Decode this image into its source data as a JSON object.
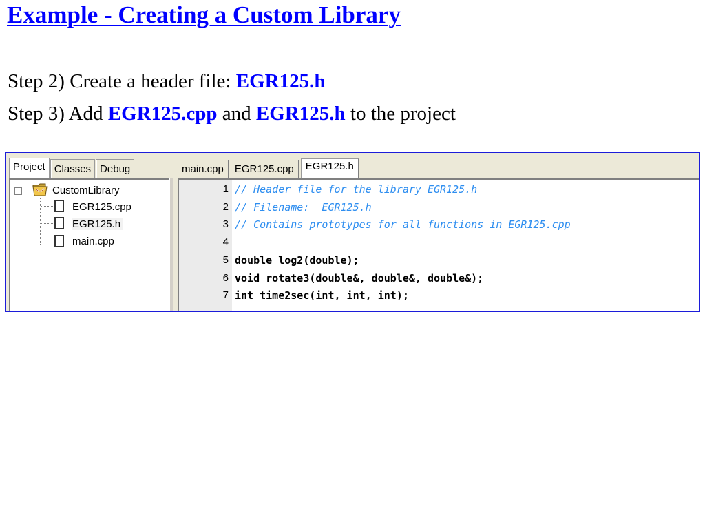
{
  "slide": {
    "title": "Example - Creating a Custom Library",
    "step2": {
      "prefix": "Step 2)  Create a header file:  ",
      "file": "EGR125.h"
    },
    "step3": {
      "prefix": "Step 3)  Add ",
      "file1": "EGR125.cpp",
      "middle": " and ",
      "file2": "EGR125.h",
      "suffix": " to the project"
    }
  },
  "ide": {
    "left_tabs": [
      "Project",
      "Classes",
      "Debug"
    ],
    "left_active_tab": "Project",
    "tree": {
      "root": {
        "label": "CustomLibrary",
        "icon": "project-folder-icon"
      },
      "files": [
        {
          "label": "EGR125.cpp",
          "icon": "file-icon"
        },
        {
          "label": "EGR125.h",
          "icon": "file-icon"
        },
        {
          "label": "main.cpp",
          "icon": "file-icon"
        }
      ]
    },
    "editor_tabs": [
      "main.cpp",
      "EGR125.cpp",
      "EGR125.h"
    ],
    "editor_active_tab": "EGR125.h",
    "code_lines": [
      {
        "num": "1",
        "text": "// Header file for the library EGR125.h",
        "kind": "comment"
      },
      {
        "num": "2",
        "text": "// Filename:  EGR125.h",
        "kind": "comment"
      },
      {
        "num": "3",
        "text": "// Contains prototypes for all functions in EGR125.cpp",
        "kind": "comment"
      },
      {
        "num": "4",
        "text": "",
        "kind": "plain"
      },
      {
        "num": "5",
        "text": "double log2(double);",
        "kind": "plain"
      },
      {
        "num": "6",
        "text": "void rotate3(double&, double&, double&);",
        "kind": "plain"
      },
      {
        "num": "7",
        "text": "int time2sec(int, int, int);",
        "kind": "plain"
      }
    ],
    "colors": {
      "frame_border": "#1c1cd9",
      "comment": "#2e8ef0",
      "title": "#0000ff"
    }
  }
}
